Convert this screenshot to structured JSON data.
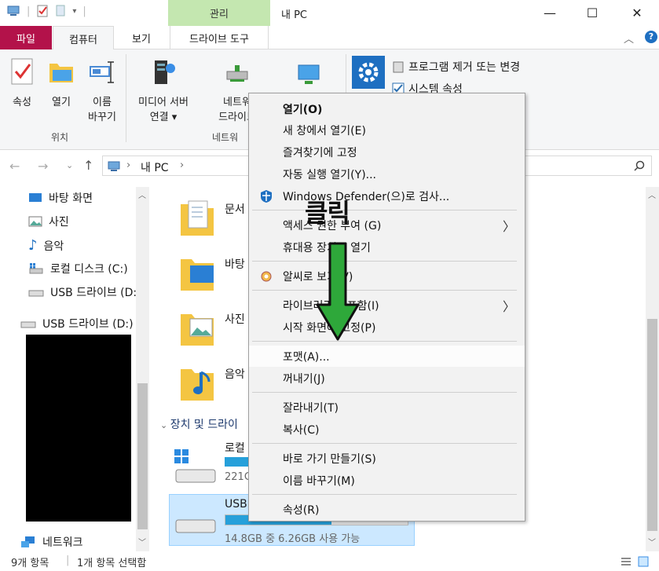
{
  "window": {
    "title": "내 PC",
    "context_tab": "관리",
    "minimize": "—",
    "maximize": "☐",
    "close": "✕"
  },
  "tabs": {
    "file": "파일",
    "computer": "컴퓨터",
    "view": "보기",
    "drive_tools": "드라이브 도구"
  },
  "ribbon": {
    "properties": "속성",
    "open": "열기",
    "rename_1": "이름",
    "rename_2": "바꾸기",
    "location_group": "위치",
    "media_1": "미디어 서버",
    "media_2": "연결 ▾",
    "network_1": "네트워",
    "network_2": "드라이브",
    "network_group": "네트워",
    "uninstall": "프로그램 제거 또는 변경",
    "system_props": "시스템 속성"
  },
  "address": {
    "path_root": "내 PC",
    "sep": "›"
  },
  "nav": {
    "items": [
      "바탕 화면",
      "사진",
      "음악",
      "로컬 디스크 (C:)",
      "USB 드라이브 (D:",
      "USB 드라이브 (D:)",
      "네트워크"
    ]
  },
  "content": {
    "folders": [
      "문서",
      "바탕",
      "사진",
      "음악"
    ],
    "section": "장치 및 드라이",
    "local_disk": "로컬",
    "local_free": "221G",
    "usb": "USB",
    "usb_free": "14.8GB 중 6.26GB 사용 가능"
  },
  "status": {
    "count": "9개 항목",
    "selected": "1개 항목 선택함"
  },
  "context_menu": {
    "open": "열기(O)",
    "open_new": "새 창에서 열기(E)",
    "pin_quick": "즐겨찾기에 고정",
    "autoplay": "자동 실행 열기(Y)...",
    "defender": "Windows Defender(으)로 검사...",
    "access": "액세스 권한 부여 (G)",
    "portable": "휴대용 장치로 열기",
    "alzip": "알씨로 보기(V)",
    "library": "라이브러리에 포함(I)",
    "pin_start": "시작 화면에 고정(P)",
    "format": "포맷(A)...",
    "eject": "꺼내기(J)",
    "cut": "잘라내기(T)",
    "copy": "복사(C)",
    "shortcut": "바로 가기 만들기(S)",
    "rename": "이름 바꾸기(M)",
    "properties": "속성(R)"
  },
  "annotation": {
    "text": "클릭",
    "arrow_color": "#2ea83a"
  },
  "colors": {
    "file_tab": "#b3124a",
    "manage_tab": "#c4e7b0",
    "selection": "#cce8ff",
    "drive_bar": "#26a0da"
  }
}
